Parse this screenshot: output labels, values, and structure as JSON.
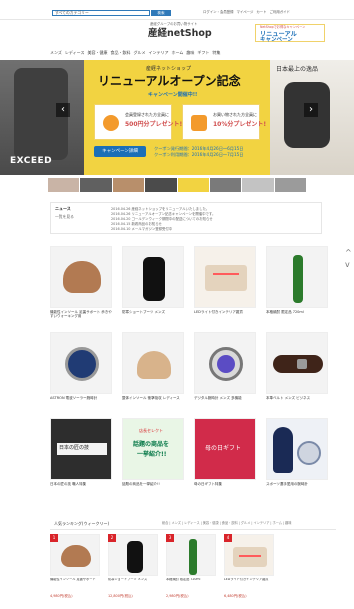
{
  "header": {
    "search_category": "すべてのカテゴリー",
    "search_button": "検索",
    "links": [
      "ログイン・会員登録",
      "マイページ",
      "カート",
      "ご利用ガイド"
    ],
    "logo_sub": "産経グループのお買い物サイト",
    "logo_main": "産経netShop",
    "promo_small": "NetShopでお得なキャンペーン",
    "promo_line1": "リニューアル",
    "promo_line2": "キャンペーン"
  },
  "menu": [
    "メンズ",
    "レディース",
    "美容・健康",
    "食品・飲料",
    "グルメ",
    "インテリア",
    "ホーム",
    "趣味",
    "ギフト",
    "特集"
  ],
  "hero": {
    "left_brand": "EXCEED",
    "right_text": "日本最上の逸品",
    "shop_name": "産経ネットショップ",
    "headline": "リニューアルオープン記念",
    "subhead": "キャンペーン開催中!!",
    "benefit1_label": "会員登録された方全員に",
    "benefit1_value": "500円分プレゼント!",
    "benefit2_label": "お買い物された方全員に",
    "benefit2_value": "10%分プレゼント!",
    "campaign_button": "キャンペーン詳細",
    "date1": "クーポン発行期間：2016年4月26日～6月15日",
    "date2": "クーポン利用期間：2016年4月26日～7月15日"
  },
  "news": {
    "title": "ニュース",
    "subtitle": "一覧を見る",
    "items": [
      "2016.04.26 産経ネットショップをリニューアルいたしました。",
      "2016.04.26 リニューアルオープン記念キャンペーンを開催中です。",
      "2016.04.20 ゴールデンウィーク期間中の配送についてのお知らせ",
      "2016.04.15 新着商品のお知らせ",
      "2016.04.10 メールマガジン登録受付中"
    ]
  },
  "products": [
    {
      "caption": "機能性インソール 足裏サポート 歩きやすいウォーキング用",
      "image": "insole"
    },
    {
      "caption": "防寒ショートブーツ メンズ",
      "image": "boots"
    },
    {
      "caption": "LEDライト付きインテリア雑貨",
      "image": "device"
    },
    {
      "caption": "本格焼酎 限定品 720ml",
      "image": "bottle"
    },
    {
      "caption": "ASTRON 電波ソーラー腕時計",
      "image": "watch-blue"
    },
    {
      "caption": "整体インソール 衝撃吸収 レディース",
      "image": "insole-flat"
    },
    {
      "caption": "デジタル腕時計 メンズ 多機能",
      "image": "watch-silver"
    },
    {
      "caption": "本革ベルト メンズ ビジネス",
      "image": "belt"
    },
    {
      "caption": "日本の匠の技 職人特集",
      "image": "craft"
    },
    {
      "caption": "話題の商品を一挙紹介!!",
      "image": "topics"
    },
    {
      "caption": "母の日ギフト特集",
      "image": "mothers-day"
    },
    {
      "caption": "スポーツ選手愛用の腕時計",
      "image": "athlete"
    }
  ],
  "tiles": {
    "craft_title": "日本の匠の技",
    "topics_line1": "話題の商品を",
    "topics_line2": "一挙紹介!!",
    "topics_label": "店長セレクト",
    "mothers_title": "母の日ギフト"
  },
  "ranking": {
    "title": "人気ランキング(ウィークリー)",
    "tabs": "総合 | メンズ | レディース | 美容・健康 | 食品・飲料 | グルメ | インテリア | ホーム | 趣味",
    "items": [
      {
        "rank": "1",
        "caption": "機能性インソール 足裏サポート",
        "price": "4,980円(税込)"
      },
      {
        "rank": "2",
        "caption": "防寒ショートブーツ メンズ",
        "price": "12,800円(税込)"
      },
      {
        "rank": "3",
        "caption": "本格焼酎 限定品 720ml",
        "price": "2,980円(税込)"
      },
      {
        "rank": "4",
        "caption": "LEDライト付きインテリア雑貨",
        "price": "6,480円(税込)"
      }
    ]
  },
  "colors": {
    "accent": "#2f79b9",
    "hero_yellow": "#f2d341",
    "rank_red": "#d9242a"
  }
}
